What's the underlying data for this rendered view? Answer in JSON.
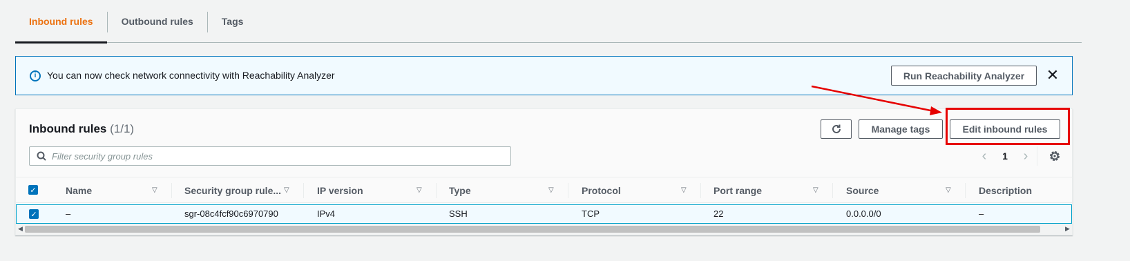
{
  "tabs": [
    {
      "label": "Inbound rules",
      "active": true
    },
    {
      "label": "Outbound rules",
      "active": false
    },
    {
      "label": "Tags",
      "active": false
    }
  ],
  "banner": {
    "text": "You can now check network connectivity with Reachability Analyzer",
    "button_label": "Run Reachability Analyzer",
    "close_glyph": "✕"
  },
  "panel": {
    "title": "Inbound rules",
    "count": "(1/1)",
    "refresh_glyph": "↻",
    "manage_tags_label": "Manage tags",
    "edit_label": "Edit inbound rules",
    "filter_placeholder": "Filter security group rules",
    "page": "1",
    "prev_glyph": "‹",
    "next_glyph": "›"
  },
  "table": {
    "columns": [
      "Name",
      "Security group rule...",
      "IP version",
      "Type",
      "Protocol",
      "Port range",
      "Source",
      "Description"
    ],
    "rows": [
      {
        "name": "–",
        "rule_id": "sgr-08c4fcf90c6970790",
        "ip_version": "IPv4",
        "type": "SSH",
        "protocol": "TCP",
        "port_range": "22",
        "source": "0.0.0.0/0",
        "description": "–"
      }
    ]
  },
  "colors": {
    "accent_orange": "#ec7211",
    "info_blue": "#0073bb",
    "annotation_red": "#e60000"
  },
  "icons": [
    "info-icon",
    "close-icon",
    "refresh-icon",
    "search-icon",
    "settings-gear-icon",
    "sort-icon",
    "checkbox-checked-icon"
  ]
}
